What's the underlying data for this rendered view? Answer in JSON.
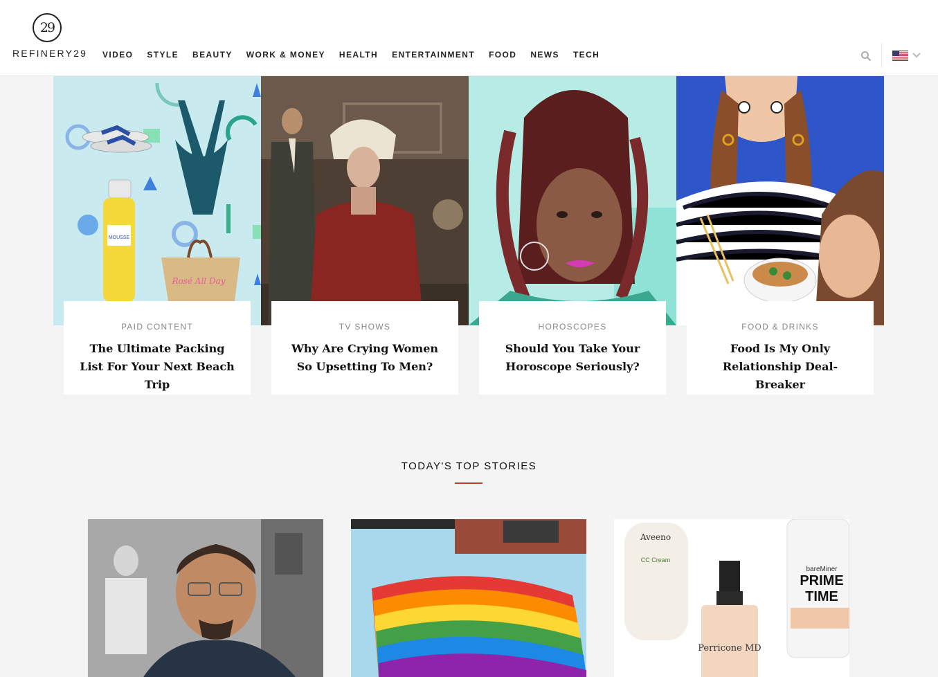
{
  "logo": {
    "mark": "29",
    "wordmark": "REFINERY29"
  },
  "nav": {
    "items": [
      "VIDEO",
      "STYLE",
      "BEAUTY",
      "WORK & MONEY",
      "HEALTH",
      "ENTERTAINMENT",
      "FOOD",
      "NEWS",
      "TECH"
    ]
  },
  "header_icons": {
    "search": "search-icon",
    "locale": "us-flag-icon",
    "locale_dropdown": "chevron-down-icon"
  },
  "features": [
    {
      "kicker": "PAID CONTENT",
      "title": "The Ultimate Packing List For Your Next Beach Trip"
    },
    {
      "kicker": "TV SHOWS",
      "title": "Why Are Crying Women So Upsetting To Men?"
    },
    {
      "kicker": "HOROSCOPES",
      "title": "Should You Take Your Horoscope Seriously?"
    },
    {
      "kicker": "FOOD & DRINKS",
      "title": "Food Is My Only Relationship Deal-Breaker"
    }
  ],
  "top_stories": {
    "heading": "TODAY'S TOP STORIES",
    "accent_color": "#c0392b"
  },
  "colors": {
    "background": "#f4f4f4",
    "header": "#ffffff",
    "accent": "#c0392b"
  }
}
